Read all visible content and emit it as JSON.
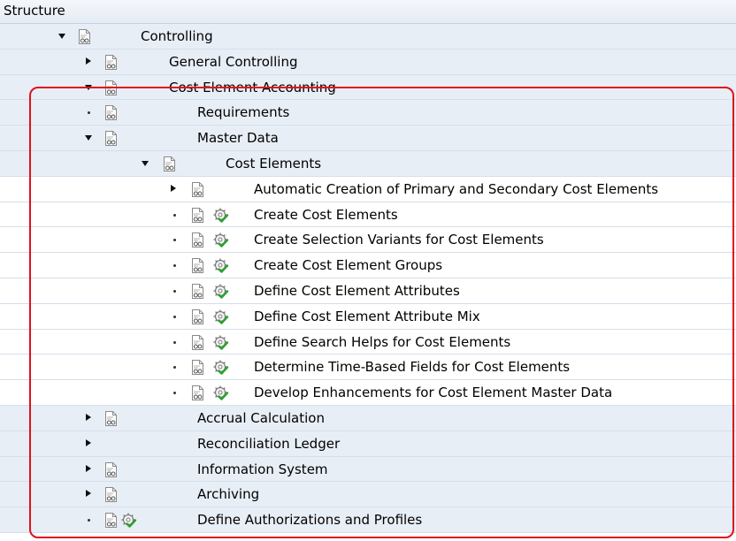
{
  "header": {
    "title": "Structure"
  },
  "tree": [
    {
      "label": "Controlling",
      "level": 0,
      "toggle": "expanded",
      "doc": true,
      "activity": false,
      "shade": true
    },
    {
      "label": "General Controlling",
      "level": 1,
      "toggle": "collapsed",
      "doc": true,
      "activity": false,
      "shade": true
    },
    {
      "label": "Cost Element Accounting",
      "level": 1,
      "toggle": "expanded",
      "doc": true,
      "activity": false,
      "shade": true
    },
    {
      "label": "Requirements",
      "level": 2,
      "toggle": "leaf",
      "doc": true,
      "activity": false,
      "shade": true
    },
    {
      "label": "Master Data",
      "level": 2,
      "toggle": "expanded",
      "doc": true,
      "activity": false,
      "shade": true
    },
    {
      "label": "Cost Elements",
      "level": 3,
      "toggle": "expanded",
      "doc": true,
      "activity": false,
      "shade": true
    },
    {
      "label": "Automatic Creation of Primary and Secondary Cost Elements",
      "level": 4,
      "toggle": "collapsed",
      "doc": true,
      "activity": false,
      "shade": false
    },
    {
      "label": "Create Cost Elements",
      "level": 4,
      "toggle": "leaf",
      "doc": true,
      "activity": true,
      "shade": false
    },
    {
      "label": "Create Selection Variants for Cost Elements",
      "level": 4,
      "toggle": "leaf",
      "doc": true,
      "activity": true,
      "shade": false
    },
    {
      "label": "Create Cost Element Groups",
      "level": 4,
      "toggle": "leaf",
      "doc": true,
      "activity": true,
      "shade": false
    },
    {
      "label": "Define Cost Element Attributes",
      "level": 4,
      "toggle": "leaf",
      "doc": true,
      "activity": true,
      "shade": false
    },
    {
      "label": "Define Cost Element Attribute Mix",
      "level": 4,
      "toggle": "leaf",
      "doc": true,
      "activity": true,
      "shade": false
    },
    {
      "label": "Define Search Helps for Cost Elements",
      "level": 4,
      "toggle": "leaf",
      "doc": true,
      "activity": true,
      "shade": false
    },
    {
      "label": "Determine Time-Based Fields for Cost Elements",
      "level": 4,
      "toggle": "leaf",
      "doc": true,
      "activity": true,
      "shade": false
    },
    {
      "label": "Develop Enhancements for Cost Element Master Data",
      "level": 4,
      "toggle": "leaf",
      "doc": true,
      "activity": true,
      "shade": false
    },
    {
      "label": "Accrual Calculation",
      "level": 2,
      "toggle": "collapsed",
      "doc": true,
      "activity": false,
      "shade": true
    },
    {
      "label": "Reconciliation Ledger",
      "level": 2,
      "toggle": "collapsed",
      "doc": false,
      "activity": false,
      "shade": true
    },
    {
      "label": "Information System",
      "level": 2,
      "toggle": "collapsed",
      "doc": true,
      "activity": false,
      "shade": true
    },
    {
      "label": "Archiving",
      "level": 2,
      "toggle": "collapsed",
      "doc": true,
      "activity": false,
      "shade": true
    },
    {
      "label": "Define Authorizations and Profiles",
      "level": 2,
      "toggle": "leaf",
      "doc": true,
      "activity": true,
      "shade": true
    }
  ]
}
